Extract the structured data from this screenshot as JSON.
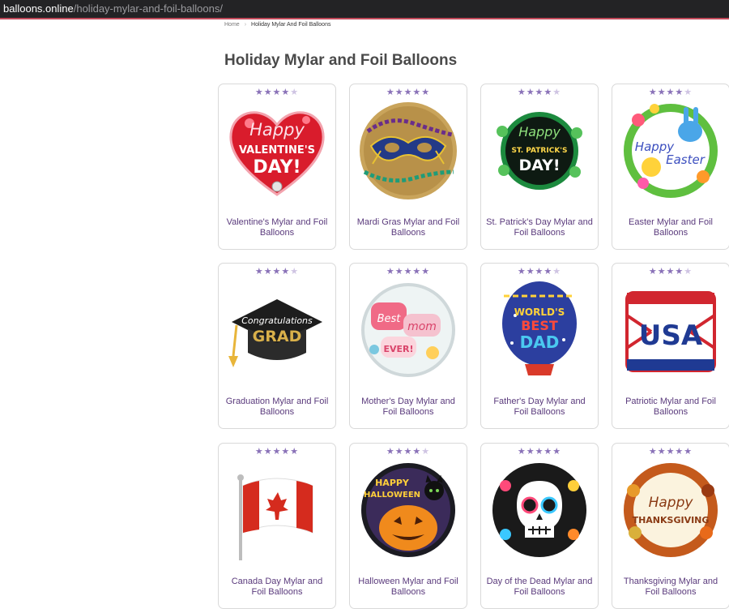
{
  "browser": {
    "url_host": "balloons.online",
    "url_path": "/holiday-mylar-and-foil-balloons/"
  },
  "breadcrumb": {
    "home": "Home",
    "separator": "›",
    "current": "Holiday Mylar And Foil Balloons"
  },
  "page": {
    "title": "Holiday Mylar and Foil Balloons"
  },
  "colors": {
    "accent": "#8a72b8",
    "caption": "#5a3a7c"
  },
  "rating_max": 5,
  "products": [
    {
      "name": "Valentine's Mylar and Foil Balloons",
      "rating": 4.5,
      "art": "valentine-heart",
      "art_text": [
        "Happy",
        "VALENTINE'S",
        "DAY!"
      ]
    },
    {
      "name": "Mardi Gras Mylar and Foil Balloons",
      "rating": 5,
      "art": "mardi-gras-mask",
      "art_text": []
    },
    {
      "name": "St. Patrick's Day Mylar and Foil Balloons",
      "rating": 4.5,
      "art": "st-patricks",
      "art_text": [
        "Happy",
        "ST. PATRICK'S",
        "DAY!"
      ]
    },
    {
      "name": "Easter Mylar and Foil Balloons",
      "rating": 4,
      "art": "easter",
      "art_text": [
        "Happy",
        "Easter"
      ]
    },
    {
      "name": "Graduation Mylar and Foil Balloons",
      "rating": 4.5,
      "art": "graduation-cap",
      "art_text": [
        "Congratulations",
        "GRAD"
      ]
    },
    {
      "name": "Mother's Day Mylar and Foil Balloons",
      "rating": 5,
      "art": "mothers-day",
      "art_text": [
        "Best",
        "mom",
        "EVER!"
      ]
    },
    {
      "name": "Father's Day Mylar and Foil Balloons",
      "rating": 4.5,
      "art": "fathers-day",
      "art_text": [
        "WORLD'S",
        "BEST",
        "DAD"
      ]
    },
    {
      "name": "Patriotic Mylar and Foil Balloons",
      "rating": 4.5,
      "art": "patriotic-cube",
      "art_text": [
        "USA"
      ]
    },
    {
      "name": "Canada Day Mylar and Foil Balloons",
      "rating": 5,
      "art": "canada-flag",
      "art_text": []
    },
    {
      "name": "Halloween Mylar and Foil Balloons",
      "rating": 4.5,
      "art": "halloween",
      "art_text": [
        "HAPPY",
        "HALLOWEEN"
      ]
    },
    {
      "name": "Day of the Dead Mylar and Foil Balloons",
      "rating": 5,
      "art": "sugar-skull",
      "art_text": []
    },
    {
      "name": "Thanksgiving Mylar and Foil Balloons",
      "rating": 5,
      "art": "thanksgiving",
      "art_text": [
        "Happy",
        "THANKSGIVING"
      ]
    }
  ]
}
